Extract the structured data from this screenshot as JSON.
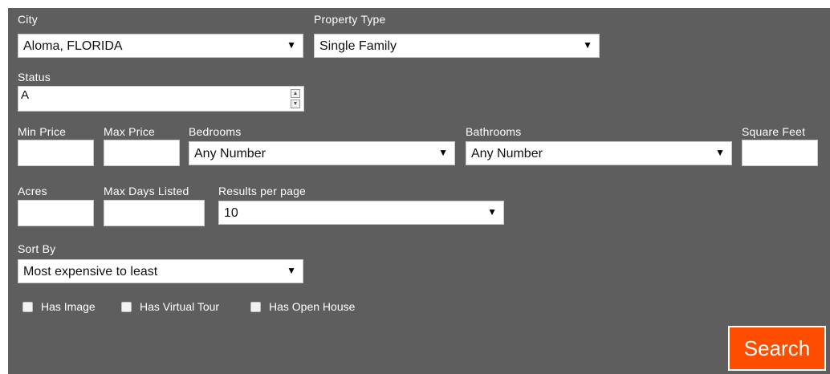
{
  "form": {
    "city": {
      "label": "City",
      "value": "Aloma, FLORIDA"
    },
    "property_type": {
      "label": "Property Type",
      "value": "Single Family"
    },
    "status": {
      "label": "Status",
      "value": "A"
    },
    "min_price": {
      "label": "Min Price",
      "value": ""
    },
    "max_price": {
      "label": "Max Price",
      "value": ""
    },
    "bedrooms": {
      "label": "Bedrooms",
      "value": "Any Number"
    },
    "bathrooms": {
      "label": "Bathrooms",
      "value": "Any Number"
    },
    "square_feet": {
      "label": "Square Feet",
      "value": ""
    },
    "acres": {
      "label": "Acres",
      "value": ""
    },
    "max_days_listed": {
      "label": "Max Days Listed",
      "value": ""
    },
    "results_per_page": {
      "label": "Results per page",
      "value": "10"
    },
    "sort_by": {
      "label": "Sort By",
      "value": "Most expensive to least"
    },
    "checkboxes": [
      {
        "label": "Has Image",
        "checked": false
      },
      {
        "label": "Has Virtual Tour",
        "checked": false
      },
      {
        "label": "Has Open House",
        "checked": false
      }
    ],
    "search_label": "Search"
  },
  "icons": {
    "select_arrow": "dropdown-arrow-icon",
    "spinner": "spinner-arrows-icon"
  },
  "colors": {
    "panel_bg": "#5e5e5e",
    "accent": "#ff4d00",
    "text": "#ffffff"
  }
}
